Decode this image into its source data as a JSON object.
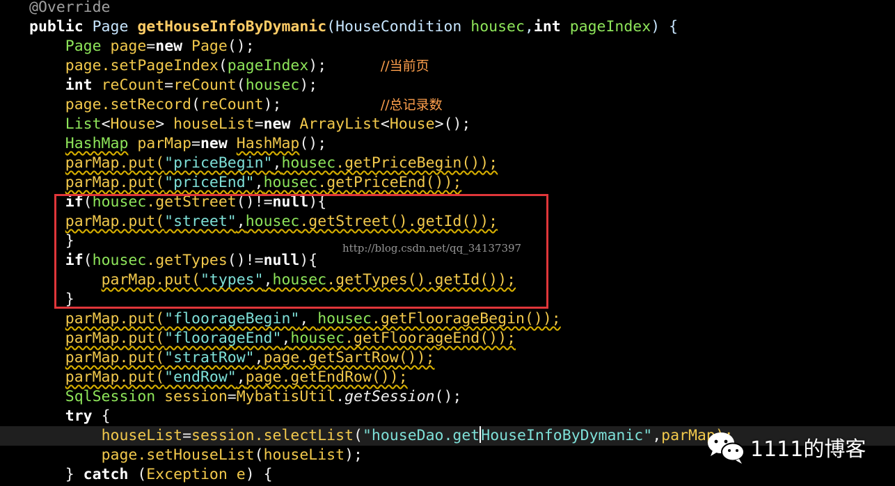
{
  "code_lines": [
    [
      {
        "text": "@Override",
        "cls": "a"
      }
    ],
    [
      {
        "text": "public ",
        "cls": "k"
      },
      {
        "text": "Page ",
        "cls": "t"
      },
      {
        "text": "getHouseInfoByDymanic",
        "cls": "f"
      },
      {
        "text": "(HouseCondition ",
        "cls": "t"
      },
      {
        "text": "housec",
        "cls": "p"
      },
      {
        "text": ",",
        "cls": "t"
      },
      {
        "text": "int ",
        "cls": "k"
      },
      {
        "text": "pageIndex",
        "cls": "p"
      },
      {
        "text": ") {",
        "cls": "t"
      }
    ],
    [
      {
        "text": "    "
      },
      {
        "text": "Page ",
        "cls": "p"
      },
      {
        "text": "page",
        "cls": "v"
      },
      {
        "text": "="
      },
      {
        "text": "new ",
        "cls": "k"
      },
      {
        "text": "Page",
        "cls": "v"
      },
      {
        "text": "();"
      }
    ],
    [
      {
        "text": "    "
      },
      {
        "text": "page.setPageIndex",
        "cls": "v"
      },
      {
        "text": "("
      },
      {
        "text": "pageIndex",
        "cls": "p"
      },
      {
        "text": ");      "
      },
      {
        "text": "//当前页",
        "cls": "c"
      }
    ],
    [
      {
        "text": "    "
      },
      {
        "text": "int ",
        "cls": "k"
      },
      {
        "text": "reCount",
        "cls": "v"
      },
      {
        "text": "="
      },
      {
        "text": "reCount",
        "cls": "v"
      },
      {
        "text": "("
      },
      {
        "text": "housec",
        "cls": "p"
      },
      {
        "text": ");"
      }
    ],
    [
      {
        "text": "    "
      },
      {
        "text": "page.setRecord",
        "cls": "v"
      },
      {
        "text": "("
      },
      {
        "text": "reCount",
        "cls": "v"
      },
      {
        "text": ");           "
      },
      {
        "text": "//总记录数",
        "cls": "c"
      }
    ],
    [
      {
        "text": "    "
      },
      {
        "text": "List",
        "cls": "p"
      },
      {
        "text": "<"
      },
      {
        "text": "House",
        "cls": "v"
      },
      {
        "text": "> "
      },
      {
        "text": "houseList",
        "cls": "v"
      },
      {
        "text": "="
      },
      {
        "text": "new ",
        "cls": "k"
      },
      {
        "text": "ArrayList",
        "cls": "v"
      },
      {
        "text": "<"
      },
      {
        "text": "House",
        "cls": "v"
      },
      {
        "text": ">();"
      }
    ],
    [
      {
        "text": "    "
      },
      {
        "text": "HashMap",
        "cls": "p w"
      },
      {
        "text": " "
      },
      {
        "text": "parMap",
        "cls": "v"
      },
      {
        "text": "="
      },
      {
        "text": "new ",
        "cls": "k"
      },
      {
        "text": "HashMap",
        "cls": "v w"
      },
      {
        "text": "();"
      }
    ],
    [
      {
        "text": "    "
      },
      {
        "text": "parMap.put(",
        "cls": "v w"
      },
      {
        "text": "\"priceBegin\"",
        "cls": "s w"
      },
      {
        "text": ",",
        "cls": "w"
      },
      {
        "text": "housec",
        "cls": "p w"
      },
      {
        "text": ".getPriceBegin());",
        "cls": "v w"
      }
    ],
    [
      {
        "text": "    "
      },
      {
        "text": "parMap.put(",
        "cls": "v w"
      },
      {
        "text": "\"priceEnd\"",
        "cls": "s w"
      },
      {
        "text": ",",
        "cls": "w"
      },
      {
        "text": "housec",
        "cls": "p w"
      },
      {
        "text": ".getPriceEnd());",
        "cls": "v w"
      }
    ],
    [
      {
        "text": "    "
      },
      {
        "text": "if",
        "cls": "k"
      },
      {
        "text": "("
      },
      {
        "text": "housec",
        "cls": "p"
      },
      {
        "text": ".getStreet",
        "cls": "v"
      },
      {
        "text": "()!="
      },
      {
        "text": "null",
        "cls": "k"
      },
      {
        "text": "){"
      }
    ],
    [
      {
        "text": "    "
      },
      {
        "text": "parMap.put(",
        "cls": "v w"
      },
      {
        "text": "\"street\"",
        "cls": "s w"
      },
      {
        "text": ",",
        "cls": "w"
      },
      {
        "text": "housec",
        "cls": "p w"
      },
      {
        "text": ".getStreet().getId());",
        "cls": "v w"
      }
    ],
    [
      {
        "text": "    }"
      }
    ],
    [
      {
        "text": "    "
      },
      {
        "text": "if",
        "cls": "k"
      },
      {
        "text": "("
      },
      {
        "text": "housec",
        "cls": "p"
      },
      {
        "text": ".getTypes",
        "cls": "v"
      },
      {
        "text": "()!="
      },
      {
        "text": "null",
        "cls": "k"
      },
      {
        "text": "){"
      }
    ],
    [
      {
        "text": "        "
      },
      {
        "text": "parMap.put(",
        "cls": "v w"
      },
      {
        "text": "\"types\"",
        "cls": "s w"
      },
      {
        "text": ",",
        "cls": "w"
      },
      {
        "text": "housec",
        "cls": "p w"
      },
      {
        "text": ".getTypes().getId());",
        "cls": "v w"
      }
    ],
    [
      {
        "text": "    }"
      }
    ],
    [
      {
        "text": "    "
      },
      {
        "text": "parMap.put(",
        "cls": "v w"
      },
      {
        "text": "\"floorageBegin\"",
        "cls": "s w"
      },
      {
        "text": ", ",
        "cls": "w"
      },
      {
        "text": "housec",
        "cls": "p w"
      },
      {
        "text": ".getFloorageBegin());",
        "cls": "v w"
      }
    ],
    [
      {
        "text": "    "
      },
      {
        "text": "parMap.put(",
        "cls": "v w"
      },
      {
        "text": "\"floorageEnd\"",
        "cls": "s w"
      },
      {
        "text": ",",
        "cls": "w"
      },
      {
        "text": "housec",
        "cls": "p w"
      },
      {
        "text": ".getFloorageEnd());",
        "cls": "v w"
      }
    ],
    [
      {
        "text": "    "
      },
      {
        "text": "parMap.put(",
        "cls": "v w"
      },
      {
        "text": "\"stratRow\"",
        "cls": "s w"
      },
      {
        "text": ",",
        "cls": "w"
      },
      {
        "text": "page.getSartRow());",
        "cls": "v w"
      }
    ],
    [
      {
        "text": "    "
      },
      {
        "text": "parMap.put(",
        "cls": "v w"
      },
      {
        "text": "\"endRow\"",
        "cls": "s w"
      },
      {
        "text": ",",
        "cls": "w"
      },
      {
        "text": "page.getEndRow());",
        "cls": "v w"
      }
    ],
    [
      {
        "text": "    "
      },
      {
        "text": "SqlSession ",
        "cls": "p"
      },
      {
        "text": "session",
        "cls": "v"
      },
      {
        "text": "="
      },
      {
        "text": "MybatisUtil",
        "cls": "v"
      },
      {
        "text": "."
      },
      {
        "text": "getSession",
        "cls": "i"
      },
      {
        "text": "();"
      }
    ],
    [
      {
        "text": "    "
      },
      {
        "text": "try",
        "cls": "k"
      },
      {
        "text": " {"
      }
    ],
    [
      {
        "text": "        "
      },
      {
        "text": "houseList",
        "cls": "v"
      },
      {
        "text": "="
      },
      {
        "text": "session.selectList",
        "cls": "v"
      },
      {
        "text": "("
      },
      {
        "text": "\"houseDao.get",
        "cls": "s"
      },
      {
        "cursor": true
      },
      {
        "text": "HouseInfoByDymanic\"",
        "cls": "s"
      },
      {
        "text": ","
      },
      {
        "text": "parMap);",
        "cls": "v"
      }
    ],
    [
      {
        "text": "        "
      },
      {
        "text": "page.setHouseList",
        "cls": "v"
      },
      {
        "text": "("
      },
      {
        "text": "houseList",
        "cls": "v"
      },
      {
        "text": ");"
      }
    ],
    [
      {
        "text": "    } "
      },
      {
        "text": "catch",
        "cls": "k"
      },
      {
        "text": " ("
      },
      {
        "text": "Exception ",
        "cls": "v"
      },
      {
        "text": "e",
        "cls": "v"
      },
      {
        "text": ") {"
      }
    ]
  ],
  "current_line_index": 22,
  "watermark_url": "http://blog.csdn.net/qq_34137397",
  "blog_name": "1111的博客",
  "colors": {
    "background": "#000000",
    "highlight_box": "#e0363a",
    "keyword": "#ffffff",
    "method": "#ffcc66",
    "string": "#7ee0d8",
    "parameter": "#8ee55a",
    "comment": "#ffa04d"
  }
}
